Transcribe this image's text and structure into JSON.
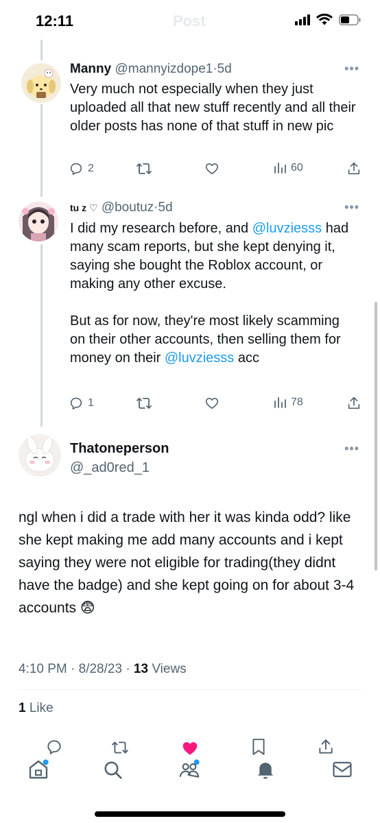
{
  "status_bar": {
    "time": "12:11",
    "header_title": "Post"
  },
  "replies": [
    {
      "name": "Manny",
      "handle": "@mannyizdope1",
      "time": "5d",
      "text": "Very much not especially when they just uploaded all that new stuff recently and all their older posts has none of that stuff in new pic",
      "reply_count": "2",
      "views": "60"
    },
    {
      "name": "tu z ♡",
      "handle": "@boutuz",
      "time": "5d",
      "para1_a": "I did my research before, and ",
      "para1_mention": "@luvziesss",
      "para1_b": " had many scam reports, but she kept denying it, saying she bought the Roblox account, or making any other excuse.",
      "para2_a": "But as for now, they're most likely scamming on their other accounts, then selling them for money on their ",
      "para2_mention": "@luvziesss",
      "para2_b": " acc",
      "reply_count": "1",
      "views": "78"
    }
  ],
  "main_post": {
    "name": "Thatoneperson",
    "handle": "@_ad0red_1",
    "text": "ngl when i did a trade with her it was kinda odd? like she kept making me add many accounts and i kept saying they were not eligible for trading(they didnt have the badge) and she kept going on for about 3-4 accounts 😨",
    "datetime": "4:10 PM · 8/28/23 · ",
    "views_count": "13",
    "views_label": " Views",
    "likes_count": "1",
    "likes_label": " Like"
  },
  "colors": {
    "accent": "#1d9bf0",
    "like_pink": "#f91880",
    "secondary": "#536471"
  }
}
